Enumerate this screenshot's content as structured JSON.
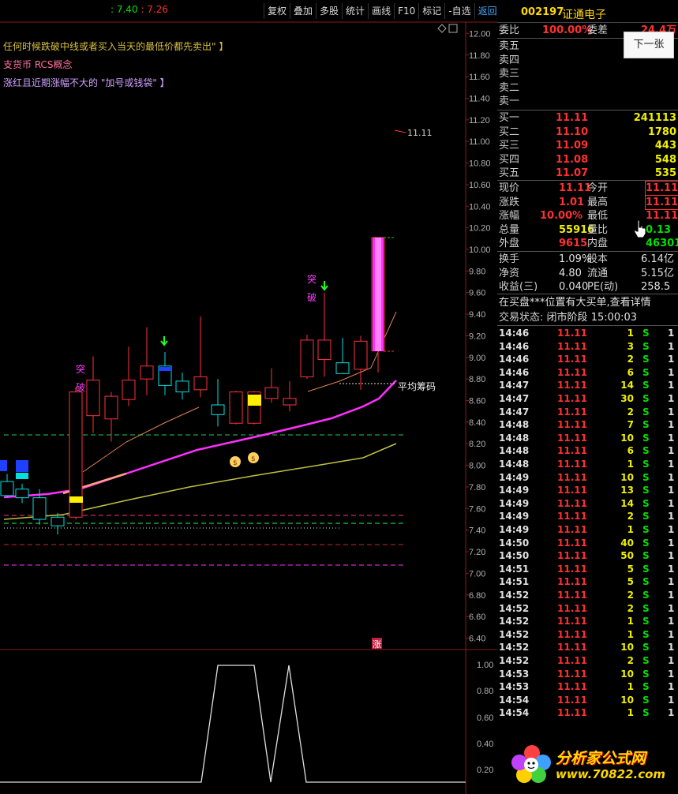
{
  "toolbar": [
    "复权",
    "叠加",
    "多股",
    "统计",
    "画线",
    "F10",
    "标记",
    "-自选",
    "返回"
  ],
  "header_values": {
    "v1": ": 7.40",
    "v2": ": 7.26",
    "c1": "#00e000",
    "c2": "#ff3030"
  },
  "notes": [
    {
      "text": "任何时候跌破中线或者买入当天的最低价都先卖出\"  】",
      "color": "#d8c040"
    },
    {
      "text": "支货币 RCS概念",
      "color": "#ff70a0"
    },
    {
      "text": "涨红且近期涨幅不大的 \"加号或钱袋\"  】",
      "color": "#d0a0ff"
    }
  ],
  "chart_labels": {
    "breakout1": "突\n破",
    "breakout_b1": "突",
    "breakout_b2": "破",
    "avg_cost": "平均筹码",
    "price_mark": "11.11",
    "limit_up": "涨",
    "rollback": "返回"
  },
  "price_axis": [
    "12.00",
    "11.80",
    "11.60",
    "11.40",
    "11.20",
    "11.00",
    "10.80",
    "10.60",
    "10.40",
    "10.20",
    "10.00",
    "9.80",
    "9.60",
    "9.40",
    "9.20",
    "9.00",
    "8.80",
    "8.60",
    "8.40",
    "8.20",
    "8.00",
    "7.80",
    "7.60",
    "7.40",
    "7.20",
    "7.00",
    "6.80",
    "6.60",
    "6.40"
  ],
  "sub_axis": [
    "1.00",
    "0.80",
    "0.60",
    "0.40",
    "0.20"
  ],
  "chart_data": {
    "type": "candlestick",
    "candles": [
      {
        "o": 7.85,
        "c": 7.72,
        "h": 7.92,
        "l": 7.7
      },
      {
        "o": 7.78,
        "c": 7.7,
        "h": 7.83,
        "l": 7.65
      },
      {
        "o": 7.7,
        "c": 7.5,
        "h": 7.78,
        "l": 7.45
      },
      {
        "o": 7.52,
        "c": 7.44,
        "h": 7.56,
        "l": 7.36
      },
      {
        "o": 7.52,
        "c": 8.68,
        "h": 8.72,
        "l": 7.5
      },
      {
        "o": 8.46,
        "c": 8.79,
        "h": 9.01,
        "l": 8.3
      },
      {
        "o": 8.43,
        "c": 8.64,
        "h": 8.68,
        "l": 8.22
      },
      {
        "o": 8.61,
        "c": 8.79,
        "h": 9.1,
        "l": 8.55
      },
      {
        "o": 8.8,
        "c": 8.92,
        "h": 9.28,
        "l": 8.65
      },
      {
        "o": 8.92,
        "c": 8.74,
        "h": 9.05,
        "l": 8.65
      },
      {
        "o": 8.78,
        "c": 8.68,
        "h": 8.86,
        "l": 8.61
      },
      {
        "o": 8.7,
        "c": 8.82,
        "h": 9.38,
        "l": 8.63
      },
      {
        "o": 8.56,
        "c": 8.47,
        "h": 8.8,
        "l": 8.36
      },
      {
        "o": 8.39,
        "c": 8.68,
        "h": 8.69,
        "l": 8.38
      },
      {
        "o": 8.39,
        "c": 8.68,
        "h": 8.69,
        "l": 8.38
      },
      {
        "o": 8.62,
        "c": 8.72,
        "h": 8.9,
        "l": 8.58
      },
      {
        "o": 8.56,
        "c": 8.62,
        "h": 8.78,
        "l": 8.5
      },
      {
        "o": 8.82,
        "c": 9.16,
        "h": 9.21,
        "l": 8.8
      },
      {
        "o": 8.98,
        "c": 9.16,
        "h": 9.6,
        "l": 8.82
      },
      {
        "o": 8.95,
        "c": 8.85,
        "h": 9.18,
        "l": 8.85
      },
      {
        "o": 8.89,
        "c": 9.15,
        "h": 9.2,
        "l": 8.7
      },
      {
        "o": 9.06,
        "c": 10.11,
        "h": 10.11,
        "l": 8.86
      }
    ]
  },
  "quote": {
    "code": "002197",
    "name": "证通电子",
    "weibi_label": "委比",
    "weibi": "100.00%",
    "weicha_label": "委差",
    "weicha": "24.4万",
    "sells": [
      "卖五",
      "卖四",
      "卖三",
      "卖二",
      "卖一"
    ],
    "buys": [
      {
        "label": "买一",
        "price": "11.11",
        "vol": "241113"
      },
      {
        "label": "买二",
        "price": "11.10",
        "vol": "1780"
      },
      {
        "label": "买三",
        "price": "11.09",
        "vol": "443"
      },
      {
        "label": "买四",
        "price": "11.08",
        "vol": "548"
      },
      {
        "label": "买五",
        "price": "11.07",
        "vol": "535"
      }
    ],
    "stats": [
      {
        "l1": "现价",
        "v1": "11.11",
        "c1": "red",
        "l2": "今开",
        "v2": "11.11",
        "c2": "red",
        "b2": true
      },
      {
        "l1": "涨跌",
        "v1": "1.01",
        "c1": "red",
        "l2": "最高",
        "v2": "11.11",
        "c2": "red",
        "b2": true
      },
      {
        "l1": "涨幅",
        "v1": "10.00%",
        "c1": "red",
        "l2": "最低",
        "v2": "11.11",
        "c2": "red",
        "b2": false
      },
      {
        "l1": "总量",
        "v1": "55916",
        "c1": "yellow",
        "l2": "量比",
        "v2": "0.13",
        "c2": "green",
        "b2": false
      },
      {
        "l1": "外盘",
        "v1": "9615",
        "c1": "red",
        "l2": "内盘",
        "v2": "46301",
        "c2": "green",
        "b2": false
      }
    ],
    "stats2": [
      {
        "l1": "换手",
        "v1": "1.09%",
        "l2": "股本",
        "v2": "6.14亿"
      },
      {
        "l1": "净资",
        "v1": "4.80",
        "l2": "流通",
        "v2": "5.15亿"
      },
      {
        "l1": "收益(三)",
        "v1": "0.040",
        "l2": "PE(动)",
        "v2": "258.5"
      }
    ],
    "notice": "在买盘***位置有大买单,查看详情",
    "status_label": "交易状态:",
    "status": "闭市阶段",
    "status_time": "15:00:03"
  },
  "next_button": "下一张",
  "ticks": [
    [
      "14:46",
      "11.11",
      "1",
      "S"
    ],
    [
      "14:46",
      "11.11",
      "3",
      "S"
    ],
    [
      "14:46",
      "11.11",
      "2",
      "S"
    ],
    [
      "14:46",
      "11.11",
      "6",
      "S"
    ],
    [
      "14:47",
      "11.11",
      "14",
      "S"
    ],
    [
      "14:47",
      "11.11",
      "30",
      "S"
    ],
    [
      "14:47",
      "11.11",
      "2",
      "S"
    ],
    [
      "14:48",
      "11.11",
      "7",
      "S"
    ],
    [
      "14:48",
      "11.11",
      "10",
      "S"
    ],
    [
      "14:48",
      "11.11",
      "6",
      "S"
    ],
    [
      "14:48",
      "11.11",
      "1",
      "S"
    ],
    [
      "14:49",
      "11.11",
      "10",
      "S"
    ],
    [
      "14:49",
      "11.11",
      "13",
      "S"
    ],
    [
      "14:49",
      "11.11",
      "14",
      "S"
    ],
    [
      "14:49",
      "11.11",
      "2",
      "S"
    ],
    [
      "14:49",
      "11.11",
      "1",
      "S"
    ],
    [
      "14:50",
      "11.11",
      "40",
      "S"
    ],
    [
      "14:50",
      "11.11",
      "50",
      "S"
    ],
    [
      "14:51",
      "11.11",
      "5",
      "S"
    ],
    [
      "14:51",
      "11.11",
      "5",
      "S"
    ],
    [
      "14:52",
      "11.11",
      "2",
      "S"
    ],
    [
      "14:52",
      "11.11",
      "2",
      "S"
    ],
    [
      "14:52",
      "11.11",
      "1",
      "S"
    ],
    [
      "14:52",
      "11.11",
      "1",
      "S"
    ],
    [
      "14:52",
      "11.11",
      "10",
      "S"
    ],
    [
      "14:52",
      "11.11",
      "2",
      "S"
    ],
    [
      "14:53",
      "11.11",
      "10",
      "S"
    ],
    [
      "14:53",
      "11.11",
      "1",
      "S"
    ],
    [
      "14:54",
      "11.11",
      "10",
      "S"
    ],
    [
      "14:54",
      "11.11",
      "1",
      "S"
    ]
  ],
  "logo": {
    "line1": "分析家公式网",
    "line2": "www.70822.com"
  }
}
